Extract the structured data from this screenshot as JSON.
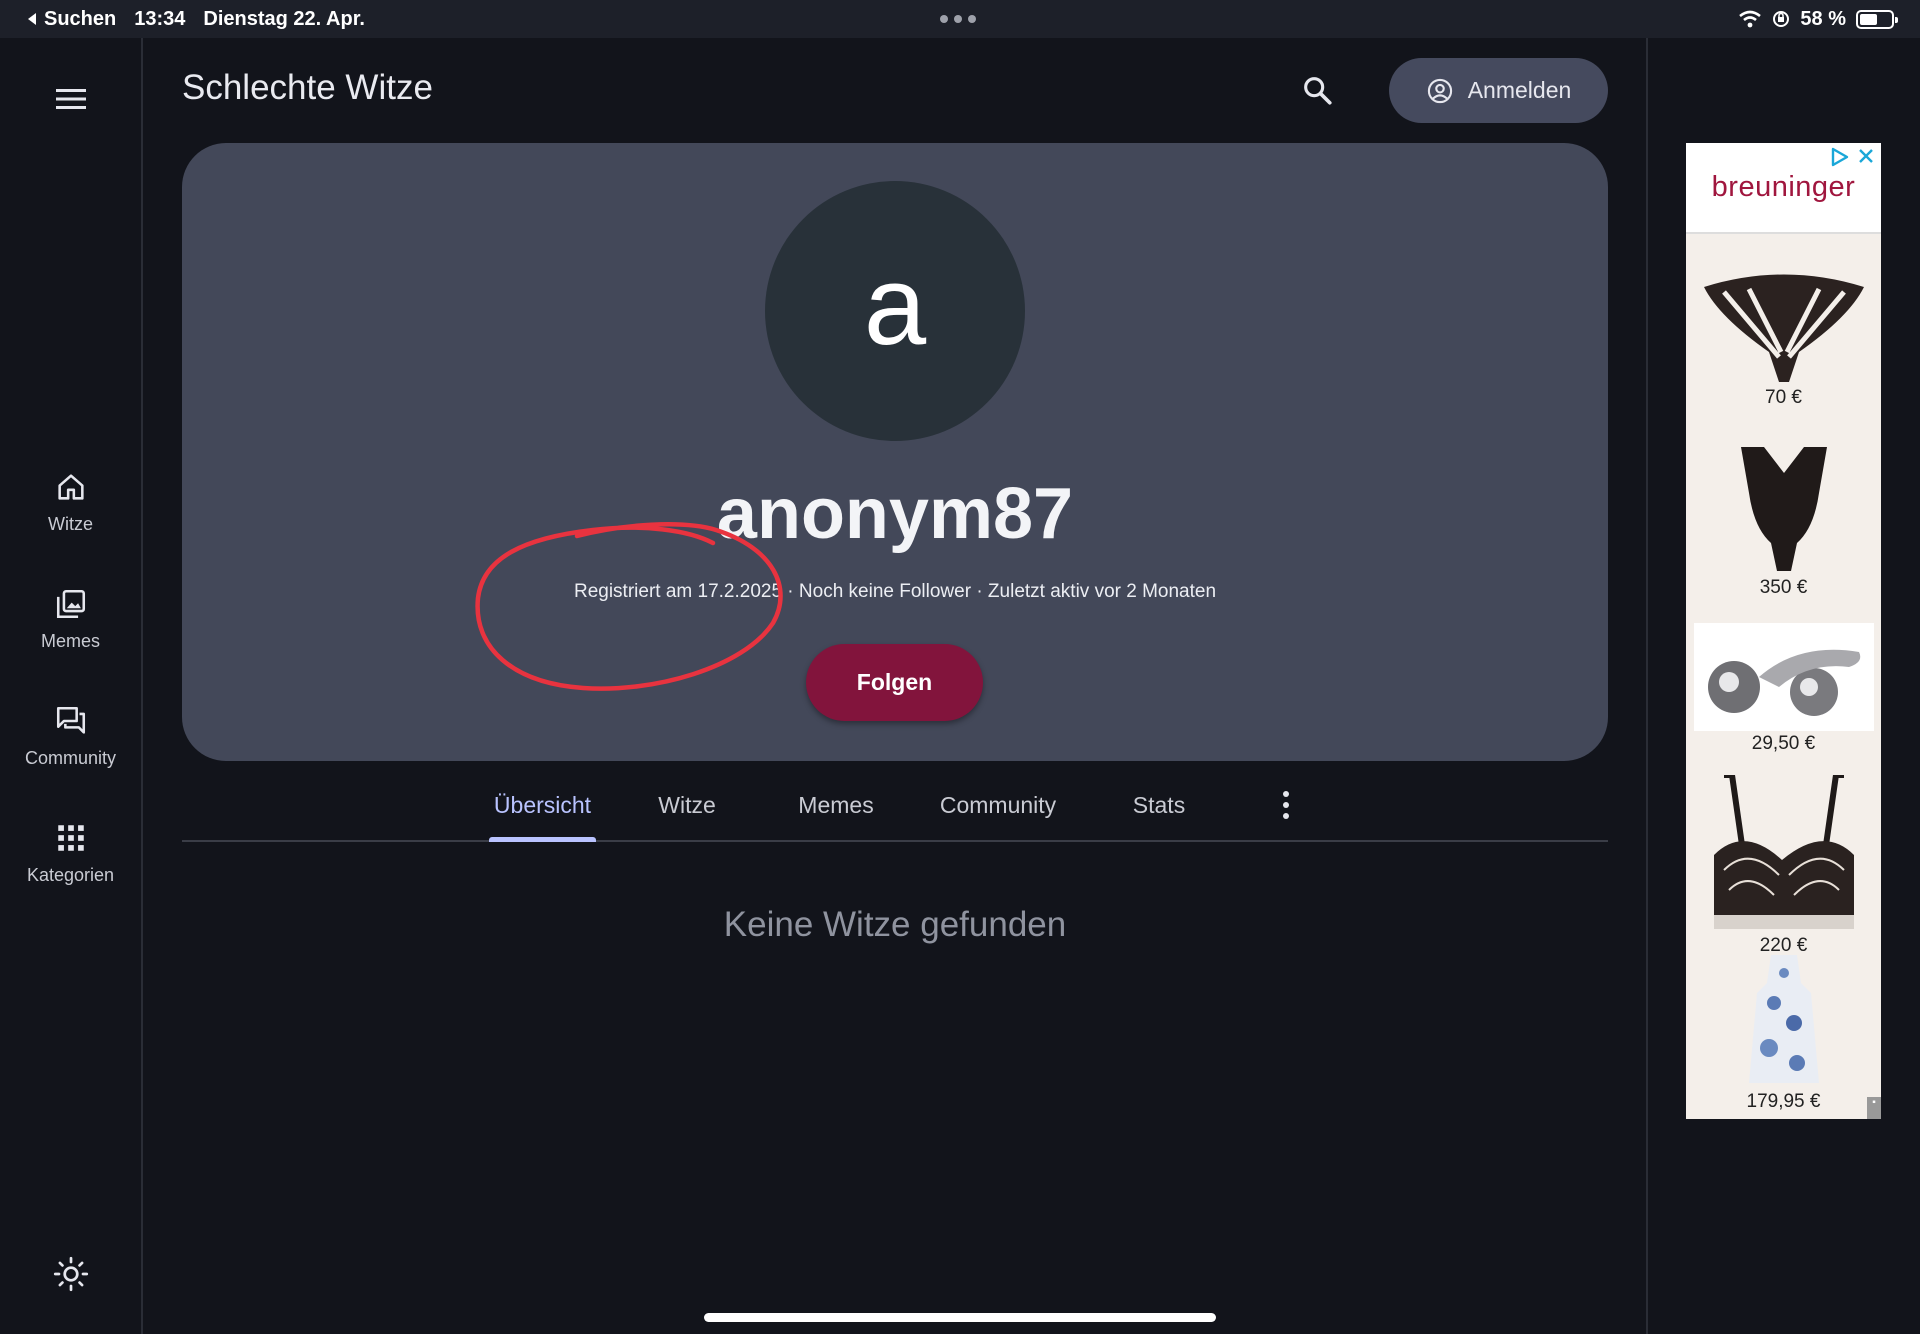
{
  "status_bar": {
    "back_label": "Suchen",
    "time": "13:34",
    "date": "Dienstag 22. Apr.",
    "battery_label": "58 %",
    "battery_level": 0.58
  },
  "rail": {
    "items": [
      {
        "label": "Witze",
        "icon": "home-icon"
      },
      {
        "label": "Memes",
        "icon": "gallery-icon"
      },
      {
        "label": "Community",
        "icon": "forum-icon"
      },
      {
        "label": "Kategorien",
        "icon": "apps-grid-icon"
      }
    ]
  },
  "header": {
    "title": "Schlechte Witze",
    "login_label": "Anmelden"
  },
  "profile": {
    "avatar_letter": "a",
    "username": "anonym87",
    "meta": "Registriert am 17.2.2025 · Noch keine Follower · Zuletzt aktiv vor 2 Monaten",
    "follow_label": "Folgen"
  },
  "tabs": [
    {
      "label": "Übersicht",
      "active": true
    },
    {
      "label": "Witze",
      "active": false
    },
    {
      "label": "Memes",
      "active": false
    },
    {
      "label": "Community",
      "active": false
    },
    {
      "label": "Stats",
      "active": false
    }
  ],
  "empty_message": "Keine Witze gefunden",
  "ad": {
    "brand": "breuninger",
    "products": [
      {
        "price": "70 €"
      },
      {
        "price": "350 €"
      },
      {
        "price": "29,50 €"
      },
      {
        "price": "220 €"
      },
      {
        "price": "179,95 €"
      }
    ]
  },
  "colors": {
    "background": "#12141b",
    "card": "#434859",
    "accent_tab": "#b9c3ff",
    "follow_button": "#82143c",
    "annotation": "#e8333f"
  }
}
